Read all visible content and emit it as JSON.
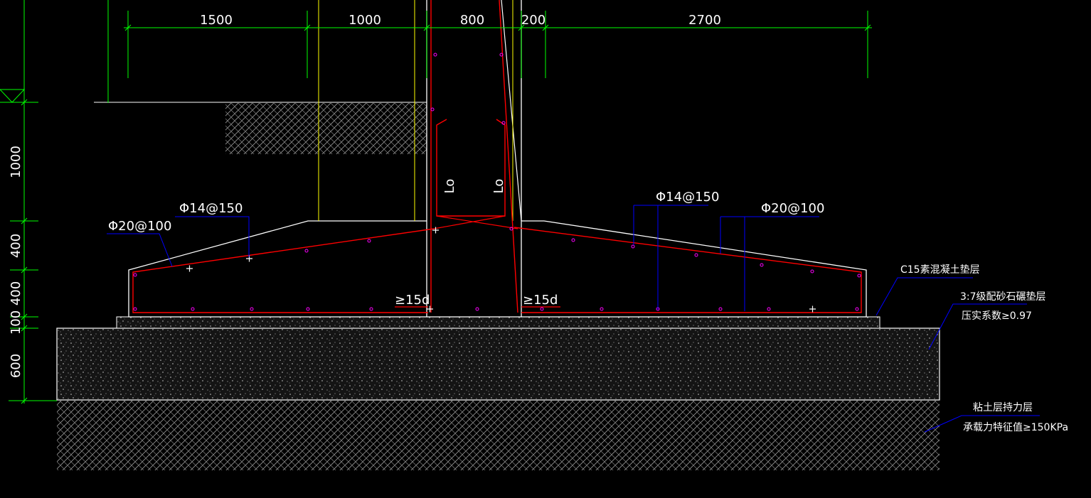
{
  "drawing": {
    "colors": {
      "background": "#000000",
      "dimension": "#00ff00",
      "outline": "#ffffff",
      "rebar": "#ff0000",
      "leader": "#0000ff",
      "guide": "#ffff00",
      "rebar_dot": "#ff00ff"
    },
    "dimensions_top": [
      "1500",
      "1000",
      "800",
      "200",
      "2700"
    ],
    "dimensions_left": [
      "1000",
      "400",
      "400",
      "100",
      "600"
    ],
    "rebar_labels": {
      "left_bottom": "Φ20@100",
      "left_top": "Φ14@150",
      "right_top": "Φ14@150",
      "right_bottom": "Φ20@100"
    },
    "anchor_labels": [
      "≥15d",
      "≥15d"
    ],
    "lap_labels": [
      "Lo",
      "Lo"
    ],
    "layer_labels": {
      "cushion": "C15素混凝土垫层",
      "gravel_line1": "3:7级配砂石碾垫层",
      "gravel_line2": "压实系数≥0.97",
      "soil_line1": "粘土层持力层",
      "soil_line2": "承载力特征值≥150KPa"
    }
  }
}
